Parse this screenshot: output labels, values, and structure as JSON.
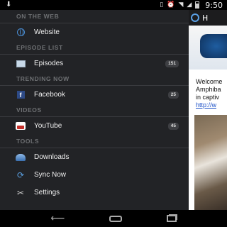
{
  "status_bar": {
    "time": "9:50",
    "notification_icon": "download-icon",
    "icons": [
      "vibrate-icon",
      "alarm-icon",
      "wifi-icon",
      "signal-icon",
      "battery-icon"
    ]
  },
  "drawer": {
    "sections": [
      {
        "header": "ON THE WEB",
        "items": [
          {
            "label": "Website",
            "icon": "globe-icon",
            "badge": null
          }
        ]
      },
      {
        "header": "EPISODE LIST",
        "items": [
          {
            "label": "Episodes",
            "icon": "episodes-icon",
            "badge": "151"
          }
        ]
      },
      {
        "header": "TRENDING NOW",
        "items": [
          {
            "label": "Facebook",
            "icon": "facebook-icon",
            "badge": "25"
          }
        ]
      },
      {
        "header": "VIDEOS",
        "items": [
          {
            "label": "YouTube",
            "icon": "youtube-icon",
            "badge": "45"
          }
        ]
      },
      {
        "header": "TOOLS",
        "items": [
          {
            "label": "Downloads",
            "icon": "downloads-icon",
            "badge": null
          },
          {
            "label": "Sync Now",
            "icon": "sync-icon",
            "badge": null
          },
          {
            "label": "Settings",
            "icon": "settings-icon",
            "badge": null
          }
        ]
      }
    ]
  },
  "content": {
    "title_partial": "H",
    "text_lines": [
      "Welcome",
      "Amphiba",
      "in captiv"
    ],
    "link_partial": "http://w"
  },
  "nav_bar": {
    "buttons": [
      "back-icon",
      "home-icon",
      "recent-apps-icon"
    ]
  },
  "colors": {
    "drawer_bg": "#222326",
    "section_header": "#6e7073",
    "badge_bg": "#3e3f43",
    "accent_blue": "#4a8fd6"
  }
}
